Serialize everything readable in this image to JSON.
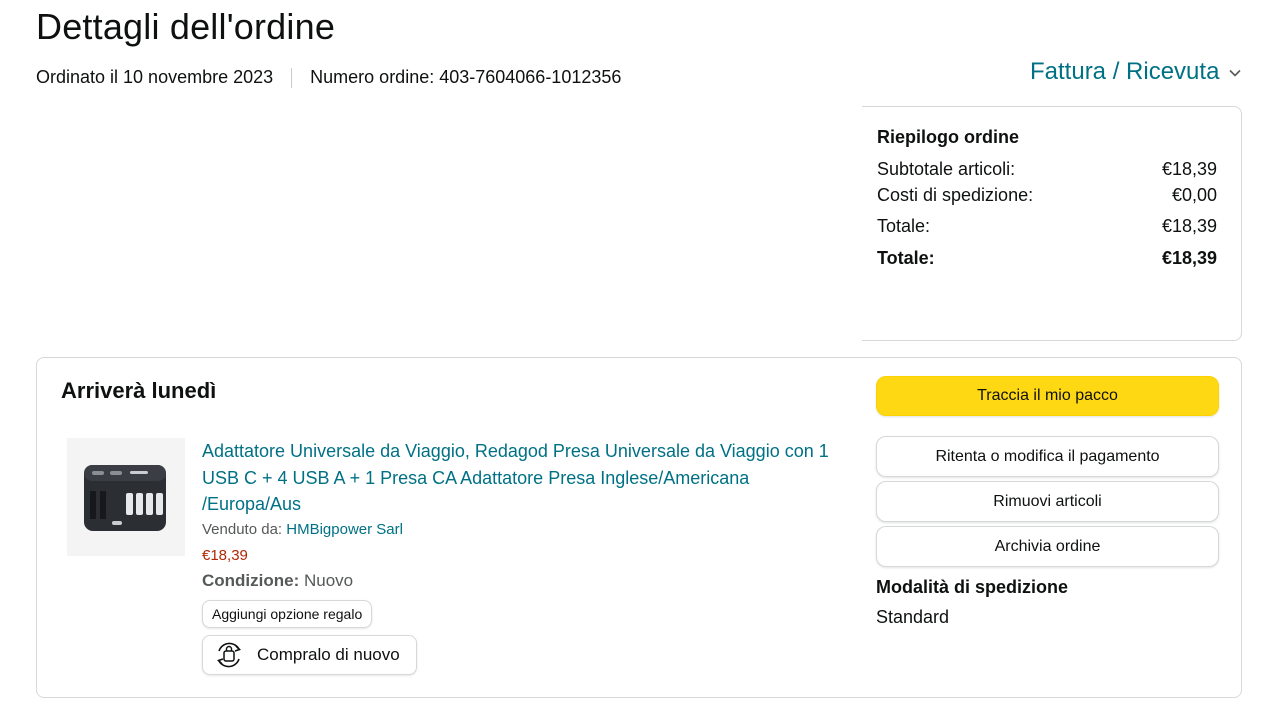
{
  "header": {
    "title": "Dettagli dell'ordine",
    "ordered_on": "Ordinato il 10 novembre 2023",
    "order_number": "Numero ordine: 403-7604066-1012356",
    "invoice_link": "Fattura / Ricevuta"
  },
  "summary": {
    "title": "Riepilogo ordine",
    "rows": [
      {
        "label": "Subtotale articoli:",
        "value": "€18,39"
      },
      {
        "label": "Costi di spedizione:",
        "value": "€0,00"
      },
      {
        "label": "Totale:",
        "value": "€18,39"
      },
      {
        "label": "Totale:",
        "value": "€18,39"
      }
    ]
  },
  "shipment": {
    "arrival": "Arriverà lunedì",
    "product": {
      "image_alt": "adapter-product-image",
      "title": "Adattatore Universale da Viaggio, Redagod Presa Universale da Viaggio con 1 USB C + 4 USB A + 1 Presa CA Adattatore Presa Inglese/Americana /Europa/Aus",
      "sold_by_label": "Venduto da: ",
      "seller": "HMBigpower Sarl",
      "price": "€18,39",
      "condition_label": "Condizione:",
      "condition_value": " Nuovo",
      "gift_option": "Aggiungi opzione regalo",
      "buy_again": "Compralo di nuovo"
    },
    "actions": {
      "track": "Traccia il mio pacco",
      "retry_payment": "Ritenta o modifica il pagamento",
      "remove_items": "Rimuovi articoli",
      "archive": "Archivia ordine"
    },
    "shipping_mode_title": "Modalità di spedizione",
    "shipping_mode": "Standard"
  },
  "colors": {
    "link": "#007185",
    "price": "#b12704",
    "primary_button": "#ffd814",
    "border": "#d5d9d9"
  }
}
